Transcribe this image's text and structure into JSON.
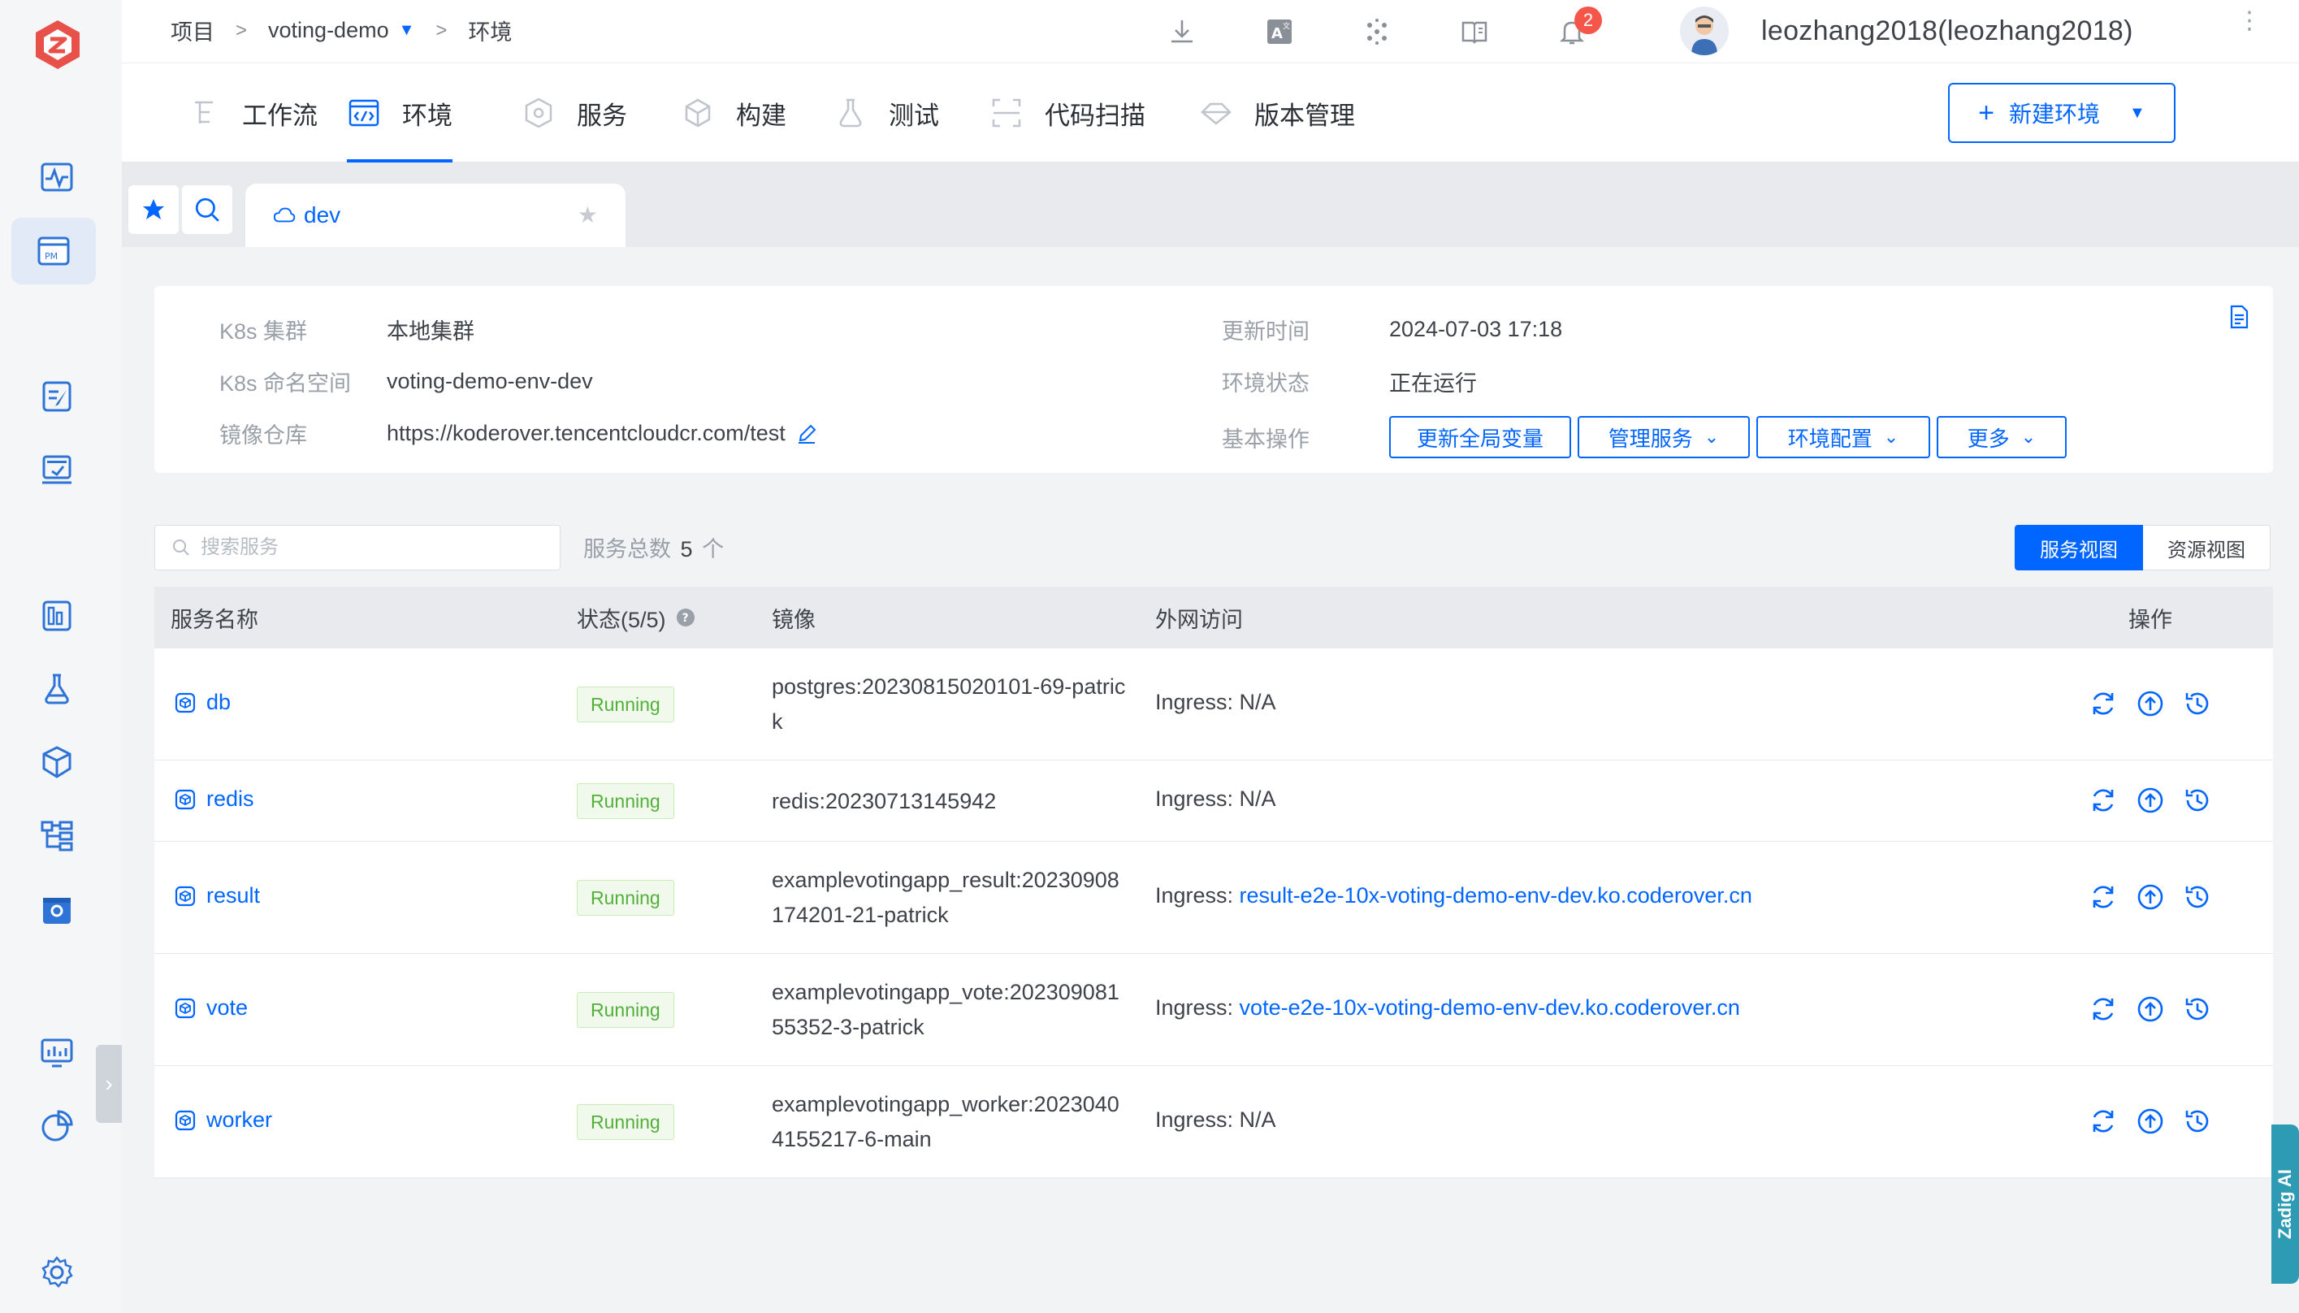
{
  "breadcrumb": {
    "root": "项目",
    "project": "voting-demo",
    "section": "环境"
  },
  "topbar": {
    "notification_count": "2",
    "user_name": "leozhang2018(leozhang2018)"
  },
  "module_tabs": [
    {
      "label": "工作流",
      "icon": "workflow-icon"
    },
    {
      "label": "环境",
      "icon": "code-env-icon"
    },
    {
      "label": "服务",
      "icon": "service-icon"
    },
    {
      "label": "构建",
      "icon": "build-icon"
    },
    {
      "label": "测试",
      "icon": "flask-icon"
    },
    {
      "label": "代码扫描",
      "icon": "scan-icon"
    },
    {
      "label": "版本管理",
      "icon": "diamond-icon"
    }
  ],
  "new_env_button": "新建环境",
  "env_tab": {
    "name": "dev"
  },
  "env_info": {
    "cluster_label": "K8s 集群",
    "cluster": "本地集群",
    "namespace_label": "K8s 命名空间",
    "namespace": "voting-demo-env-dev",
    "registry_label": "镜像仓库",
    "registry": "https://koderover.tencentcloudcr.com/test",
    "updated_label": "更新时间",
    "updated": "2024-07-03 17:18",
    "status_label": "环境状态",
    "status": "正在运行",
    "ops_label": "基本操作",
    "ops": {
      "update_vars": "更新全局变量",
      "manage_services": "管理服务",
      "env_config": "环境配置",
      "more": "更多"
    }
  },
  "toolbar": {
    "search_placeholder": "搜索服务",
    "count_prefix": "服务总数",
    "count": "5",
    "count_suffix": "个",
    "view_service": "服务视图",
    "view_resource": "资源视图"
  },
  "table": {
    "headers": {
      "name": "服务名称",
      "status": "状态(5/5)",
      "image": "镜像",
      "access": "外网访问",
      "ops": "操作"
    },
    "rows": [
      {
        "name": "db",
        "status": "Running",
        "image": "postgres:20230815020101-69-patrick",
        "access_prefix": "Ingress: ",
        "access": "N/A",
        "access_link": ""
      },
      {
        "name": "redis",
        "status": "Running",
        "image": "redis:20230713145942",
        "access_prefix": "Ingress: ",
        "access": "N/A",
        "access_link": ""
      },
      {
        "name": "result",
        "status": "Running",
        "image": "examplevotingapp_result:20230908174201-21-patrick",
        "access_prefix": "Ingress: ",
        "access": "",
        "access_link": "result-e2e-10x-voting-demo-env-dev.ko.coderover.cn"
      },
      {
        "name": "vote",
        "status": "Running",
        "image": "examplevotingapp_vote:20230908155352-3-patrick",
        "access_prefix": "Ingress: ",
        "access": "",
        "access_link": "vote-e2e-10x-voting-demo-env-dev.ko.coderover.cn"
      },
      {
        "name": "worker",
        "status": "Running",
        "image": "examplevotingapp_worker:20230404155217-6-main",
        "access_prefix": "Ingress: ",
        "access": "N/A",
        "access_link": ""
      }
    ]
  },
  "zadig_ai": "Zadig AI",
  "colors": {
    "accent": "#0066ff",
    "running": "#52b03a",
    "badge": "#f5564a"
  }
}
